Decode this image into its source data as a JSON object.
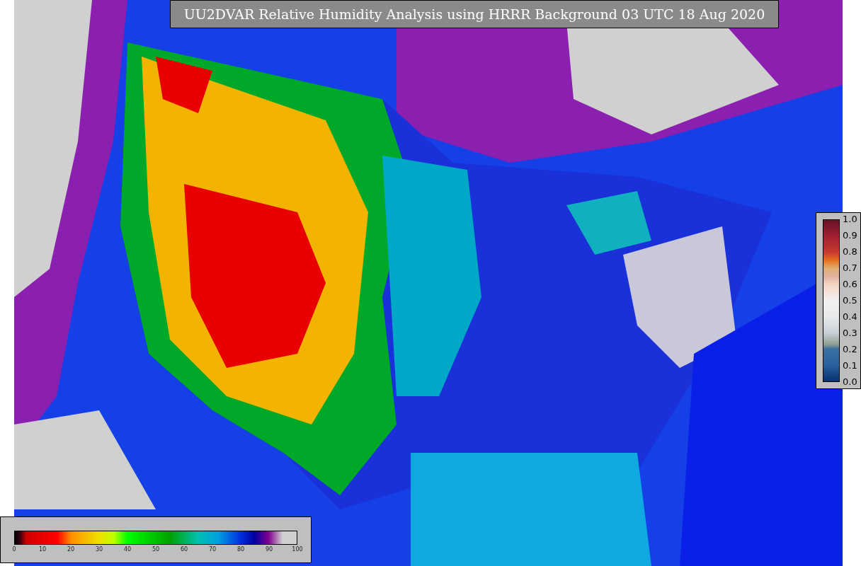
{
  "title": "UU2DVAR Relative Humidity Analysis using HRRR Background 03 UTC 18 Aug 2020",
  "humidity_colorbar": {
    "ticks": [
      "0",
      "10",
      "20",
      "30",
      "40",
      "50",
      "60",
      "70",
      "80",
      "90",
      "100"
    ]
  },
  "error_colorbar": {
    "ticks": [
      "1.0",
      "0.9",
      "0.8",
      "0.7",
      "0.6",
      "0.5",
      "0.4",
      "0.3",
      "0.2",
      "0.1",
      "0.0"
    ]
  }
}
